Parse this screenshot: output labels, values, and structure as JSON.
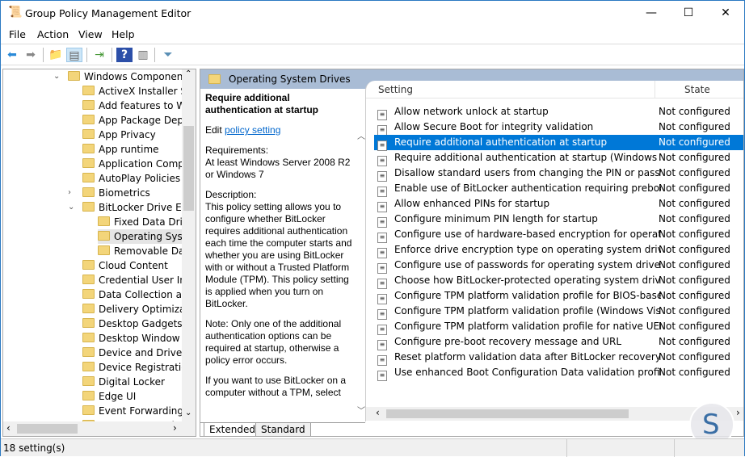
{
  "window": {
    "title": "Group Policy Management Editor",
    "minimize": "—",
    "maximize": "☐",
    "close": "✕"
  },
  "menu": [
    "File",
    "Action",
    "View",
    "Help"
  ],
  "toolbar": [
    "back-icon",
    "forward-icon",
    "up-folder-icon",
    "show-hide-tree-icon",
    "export-list-icon",
    "help-icon",
    "show-action-pane-icon",
    "filter-icon"
  ],
  "tree": {
    "root": "Windows Components",
    "items": [
      "ActiveX Installer Ser",
      "Add features to Wir",
      "App Package Deplo",
      "App Privacy",
      "App runtime",
      "Application Compa",
      "AutoPlay Policies",
      "Biometrics",
      "BitLocker Drive Enc",
      "Fixed Data Drive",
      "Operating Syste",
      "Removable Data",
      "Cloud Content",
      "Credential User Inte",
      "Data Collection and",
      "Delivery Optimizati",
      "Desktop Gadgets",
      "Desktop Window M",
      "Device and Driver C",
      "Device Registration",
      "Digital Locker",
      "Edge UI",
      "Event Forwarding",
      "Event Log Service"
    ]
  },
  "header": {
    "folder": "Operating System Drives"
  },
  "description": {
    "title": "Require additional authentication at startup",
    "edit_prefix": "Edit ",
    "edit_link": "policy setting ",
    "requirements": "Requirements:\nAt least Windows Server 2008 R2 or Windows 7",
    "description": "Description:\nThis policy setting allows you to configure whether BitLocker requires additional authentication each time the computer starts and whether you are using BitLocker with or without a Trusted Platform Module (TPM). This policy setting is applied when you turn on BitLocker.",
    "note": "Note: Only one of the additional authentication options can be required at startup, otherwise a policy error occurs.",
    "more": "If you want to use BitLocker on a computer without a TPM, select"
  },
  "list": {
    "columns": [
      "Setting",
      "State"
    ],
    "selected_index": 2,
    "rows": [
      [
        "Allow network unlock at startup",
        "Not configured"
      ],
      [
        "Allow Secure Boot for integrity validation",
        "Not configured"
      ],
      [
        "Require additional authentication at startup",
        "Not configured"
      ],
      [
        "Require additional authentication at startup (Windows Serve...",
        "Not configured"
      ],
      [
        "Disallow standard users from changing the PIN or password",
        "Not configured"
      ],
      [
        "Enable use of BitLocker authentication requiring preboot ke...",
        "Not configured"
      ],
      [
        "Allow enhanced PINs for startup",
        "Not configured"
      ],
      [
        "Configure minimum PIN length for startup",
        "Not configured"
      ],
      [
        "Configure use of hardware-based encryption for operating s...",
        "Not configured"
      ],
      [
        "Enforce drive encryption type on operating system drives",
        "Not configured"
      ],
      [
        "Configure use of passwords for operating system drives",
        "Not configured"
      ],
      [
        "Choose how BitLocker-protected operating system drives ca...",
        "Not configured"
      ],
      [
        "Configure TPM platform validation profile for BIOS-based fi...",
        "Not configured"
      ],
      [
        "Configure TPM platform validation profile (Windows Vista, ...",
        "Not configured"
      ],
      [
        "Configure TPM platform validation profile for native UEFI fir...",
        "Not configured"
      ],
      [
        "Configure pre-boot recovery message and URL",
        "Not configured"
      ],
      [
        "Reset platform validation data after BitLocker recovery",
        "Not configured"
      ],
      [
        "Use enhanced Boot Configuration Data validation profile",
        "Not configured"
      ]
    ]
  },
  "tabs": [
    "Extended",
    "Standard"
  ],
  "status": "18 setting(s)",
  "colors": {
    "selection": "#0078d7",
    "header_band": "#a9bcd5",
    "link": "#0066cc"
  }
}
